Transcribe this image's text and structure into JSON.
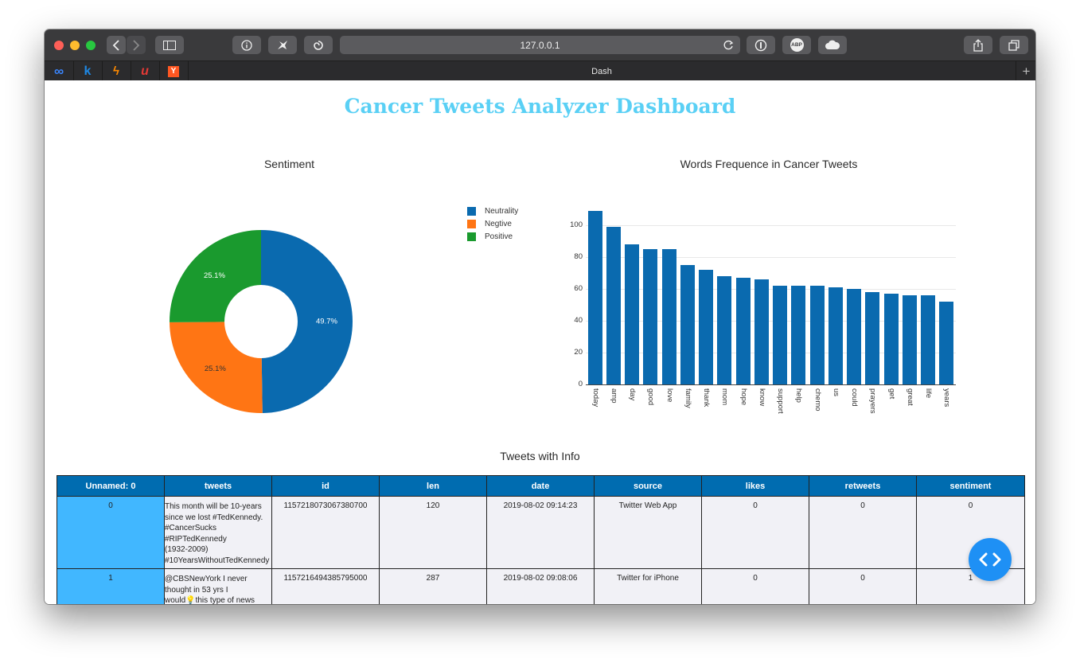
{
  "browser": {
    "url": "127.0.0.1",
    "tab_title": "Dash",
    "new_tab_glyph": "+",
    "toolbar_icons": [
      "back-icon",
      "forward-icon",
      "sidebar-icon",
      "info-icon",
      "bird-extension-icon",
      "swirl-extension-icon",
      "reload-icon",
      "onepassword-icon",
      "adblock-icon",
      "cloud-icon",
      "share-icon",
      "tabs-icon"
    ],
    "adblock_label": "ABP",
    "favorites": [
      {
        "name": "infinity-favicon",
        "glyph": "∞",
        "color": "#3a86ff"
      },
      {
        "name": "k-favicon",
        "glyph": "k",
        "color": "#1e88e5"
      },
      {
        "name": "lightning-favicon",
        "glyph": "ϟ",
        "color": "#ff8a00"
      },
      {
        "name": "u-favicon",
        "glyph": "u",
        "color": "#e53935"
      },
      {
        "name": "ycombinator-favicon",
        "glyph": "Y",
        "color": "#ff5722"
      }
    ]
  },
  "dashboard": {
    "title": "Cancer Tweets Analyzer Dashboard"
  },
  "chart_data": [
    {
      "type": "pie",
      "title": "Sentiment",
      "hole": true,
      "labels": [
        "Neutrality",
        "Negtive",
        "Positive"
      ],
      "values": [
        49.7,
        25.1,
        25.1
      ],
      "value_labels": [
        "49.7%",
        "25.1%",
        "25.1%"
      ],
      "colors": [
        "#0a6aaf",
        "#ff7514",
        "#1a9a2e"
      ],
      "legend": "right"
    },
    {
      "type": "bar",
      "title": "Words Frequence in Cancer Tweets",
      "categories": [
        "today",
        "amp",
        "day",
        "good",
        "love",
        "family",
        "thank",
        "mom",
        "hope",
        "know",
        "support",
        "help",
        "chemo",
        "us",
        "could",
        "prayers",
        "get",
        "great",
        "life",
        "years"
      ],
      "values": [
        109,
        99,
        88,
        85,
        85,
        75,
        72,
        68,
        67,
        66,
        62,
        62,
        62,
        61,
        60,
        58,
        57,
        56,
        56,
        52
      ],
      "color": "#0a6aaf",
      "ylim": [
        0,
        110
      ],
      "yticks": [
        0,
        20,
        40,
        60,
        80,
        100
      ],
      "grid": true
    }
  ],
  "table": {
    "title": "Tweets with Info",
    "columns": [
      "Unnamed: 0",
      "tweets",
      "id",
      "len",
      "date",
      "source",
      "likes",
      "retweets",
      "sentiment"
    ],
    "rows": [
      {
        "unnamed": "0",
        "tweet_lines": [
          "This month will be 10-years",
          "since we lost #TedKennedy.",
          "#CancerSucks",
          "#RIPTedKennedy",
          "(1932-2009)",
          "#10YearsWithoutTedKennedy"
        ],
        "id": "1157218073067380700",
        "len": "120",
        "date": "2019-08-02 09:14:23",
        "source": "Twitter Web App",
        "likes": "0",
        "retweets": "0",
        "sentiment": "0"
      },
      {
        "unnamed": "1",
        "tweet_lines": [
          " @CBSNewYork I never",
          "thought in 53 yrs I",
          "would💡this type of news"
        ],
        "id": "1157216494385795000",
        "len": "287",
        "date": "2019-08-02 09:08:06",
        "source": "Twitter for iPhone",
        "likes": "0",
        "retweets": "0",
        "sentiment": "1"
      }
    ]
  },
  "fab_icon": "code-brackets-icon"
}
